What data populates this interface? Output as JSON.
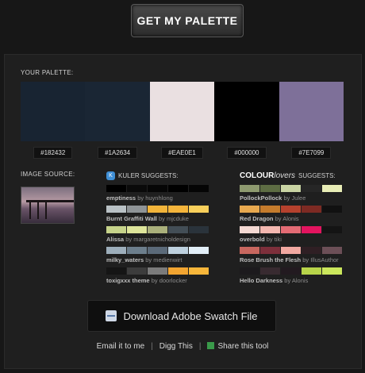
{
  "top_button": "GET MY PALETTE",
  "palette_label": "YOUR PALETTE:",
  "palette": [
    {
      "hex": "#182432",
      "color": "#182432"
    },
    {
      "hex": "#1A2634",
      "color": "#1A2634"
    },
    {
      "hex": "#EAE0E1",
      "color": "#EAE0E1"
    },
    {
      "hex": "#000000",
      "color": "#000000"
    },
    {
      "hex": "#7E7099",
      "color": "#7E7099"
    }
  ],
  "image_source_label": "IMAGE SOURCE:",
  "kuler": {
    "heading": "KULER SUGGESTS:",
    "items": [
      {
        "title": "emptiness",
        "by": "by",
        "author": "huynhlong",
        "colors": [
          "#000000",
          "#0a0a0a",
          "#060606",
          "#000000",
          "#050505"
        ]
      },
      {
        "title": "Burnt Graffiti Wall",
        "by": "by",
        "author": "mjcduke",
        "colors": [
          "#b9c1c5",
          "#8f9497",
          "#f2b43a",
          "#f5b53b",
          "#f8cf5b"
        ]
      },
      {
        "title": "Alissa",
        "by": "by",
        "author": "margaretnicholdesign",
        "colors": [
          "#c6d38a",
          "#dde49a",
          "#aab07b",
          "#434e56",
          "#2a333b"
        ]
      },
      {
        "title": "milky_waters",
        "by": "by",
        "author": "medienwirt",
        "colors": [
          "#9daebb",
          "#6c7e8c",
          "#5b6a79",
          "#bed1df",
          "#e2eff8"
        ]
      },
      {
        "title": "toxigxxx theme",
        "by": "by",
        "author": "doorlocker",
        "colors": [
          "#151515",
          "#3c3c3c",
          "#7b7b7b",
          "#f2a531",
          "#f7b63a"
        ]
      }
    ]
  },
  "colourlovers": {
    "logo_main": "COLOUR",
    "logo_sub": "lovers",
    "heading": "SUGGESTS:",
    "items": [
      {
        "title": "PollockPollock",
        "by": "by",
        "author": "Julee",
        "colors": [
          "#8e9a6f",
          "#5d6c43",
          "#c9d4a3",
          "#262626",
          "#e8edb6"
        ]
      },
      {
        "title": "Red Dragon",
        "by": "by",
        "author": "Alonis",
        "colors": [
          "#e8a94f",
          "#c47b2c",
          "#b5412d",
          "#7d2a23",
          "#111111"
        ]
      },
      {
        "title": "overbold",
        "by": "by",
        "author": "tiki",
        "colors": [
          "#f4d9d3",
          "#f3b7b0",
          "#e36b74",
          "#e3145f",
          "#141414"
        ]
      },
      {
        "title": "Rose Brush the Flesh",
        "by": "by",
        "author": "IllusAuthor",
        "colors": [
          "#c8675f",
          "#7d2f3b",
          "#f1a8a1",
          "#2f1f24",
          "#6c4f57"
        ]
      },
      {
        "title": "Hello Darkness",
        "by": "by",
        "author": "Alonis",
        "colors": [
          "#1c1a1d",
          "#382a30",
          "#221a20",
          "#b8d44a",
          "#cbe75c"
        ]
      }
    ]
  },
  "download_label": "Download Adobe Swatch File",
  "links": {
    "email": "Email it to me",
    "sep1": "|",
    "digg": "Digg This",
    "sep2": "|",
    "share": "Share this tool"
  }
}
